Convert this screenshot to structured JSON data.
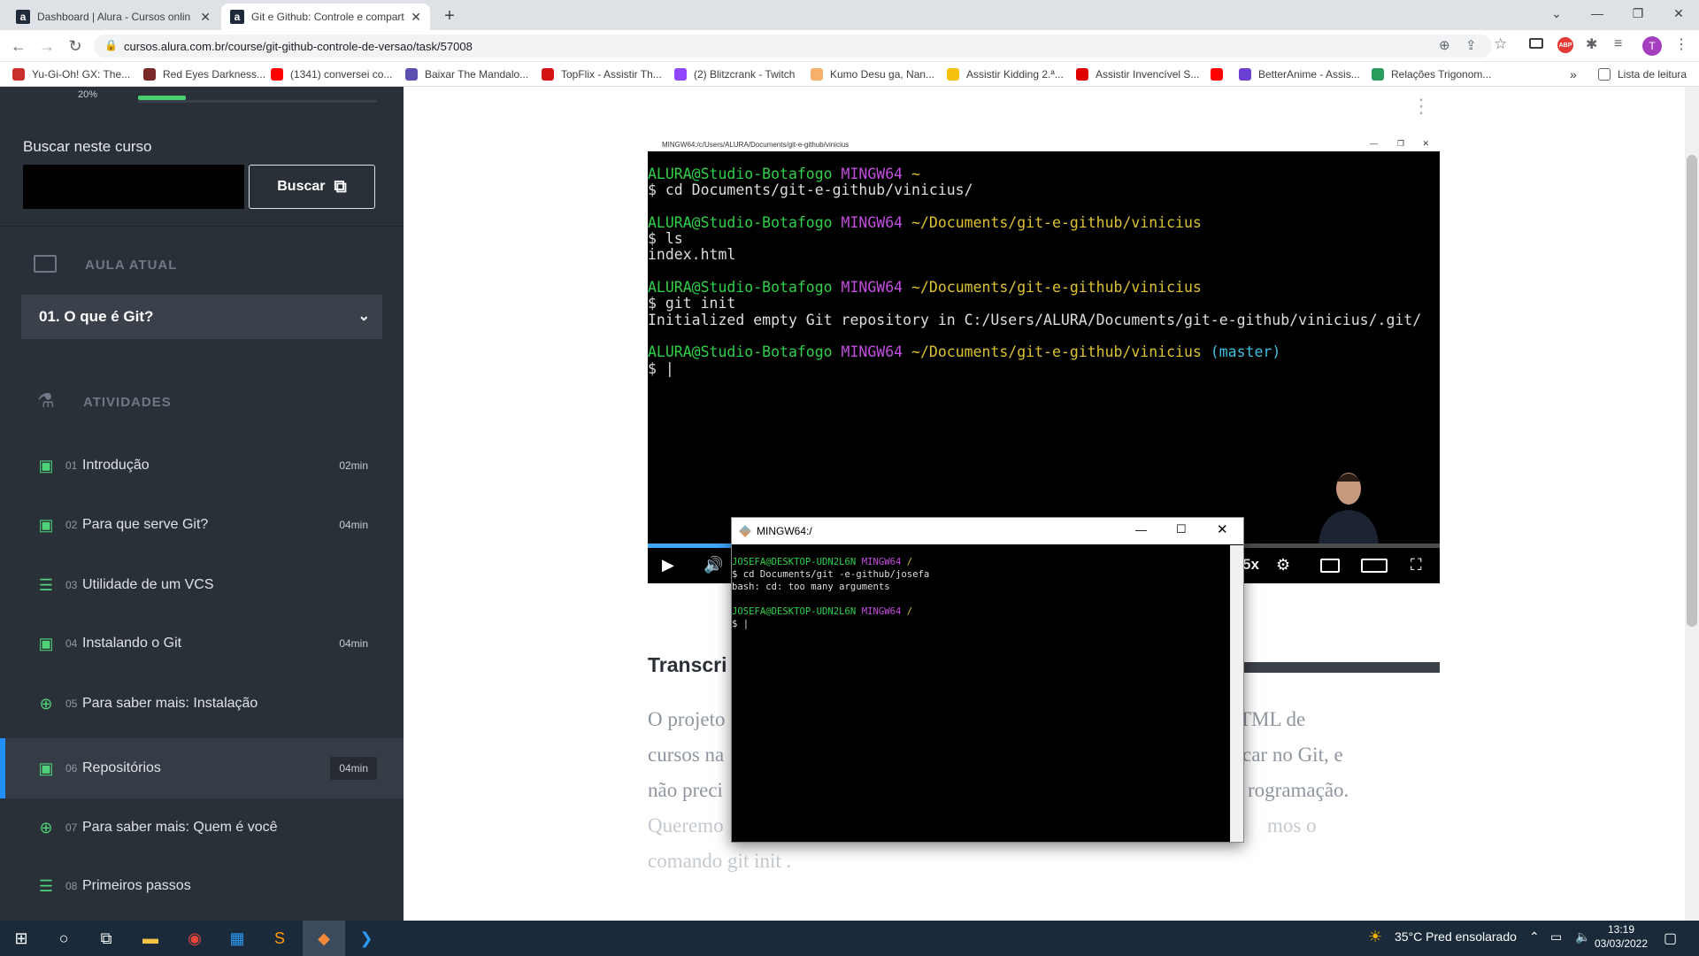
{
  "browser": {
    "tabs": [
      {
        "title": "Dashboard | Alura - Cursos onlin",
        "favicon": "a"
      },
      {
        "title": "Git e Github: Controle e compart",
        "favicon": "a"
      }
    ],
    "new_tab": "+",
    "url": "cursos.alura.com.br/course/git-github-controle-de-versao/task/57008",
    "profile_initial": "T",
    "bookmarks": [
      {
        "label": "Yu-Gi-Oh! GX: The...",
        "color": "#c9302c"
      },
      {
        "label": "Red Eyes Darkness...",
        "color": "#7b2a2a"
      },
      {
        "label": "(1341) conversei co...",
        "color": "#ff0000"
      },
      {
        "label": "Baixar The Mandalo...",
        "color": "#5b4fb0"
      },
      {
        "label": "TopFlix - Assistir Th...",
        "color": "#d41313"
      },
      {
        "label": "(2) Blitzcrank - Twitch",
        "color": "#9146ff"
      },
      {
        "label": "Kumo Desu ga, Nan...",
        "color": "#f6b26b"
      },
      {
        "label": "Assistir Kidding 2.ª...",
        "color": "#f4c20d"
      },
      {
        "label": "Assistir Invencível S...",
        "color": "#e00000"
      },
      {
        "label": "",
        "color": "#ff0000"
      },
      {
        "label": "BetterAnime - Assis...",
        "color": "#6a3fd1"
      },
      {
        "label": "Relações Trigonom...",
        "color": "#2a9d5c"
      }
    ],
    "more_bookmarks": "»",
    "reading_list": "Lista de leitura"
  },
  "sidebar": {
    "progress_percent": 20,
    "progress_label": "20%",
    "search_label": "Buscar neste curso",
    "search_placeholder": "",
    "search_button": "Buscar",
    "current_lesson_heading": "AULA ATUAL",
    "current_lesson": "01. O que é Git?",
    "activities_heading": "ATIVIDADES",
    "activities": [
      {
        "num": "01",
        "name": "Introdução",
        "duration": "02min",
        "icon": "video-icon",
        "active": false
      },
      {
        "num": "02",
        "name": "Para que serve Git?",
        "duration": "04min",
        "icon": "video-icon",
        "active": false
      },
      {
        "num": "03",
        "name": "Utilidade de um VCS",
        "duration": "",
        "icon": "list-icon",
        "active": false
      },
      {
        "num": "04",
        "name": "Instalando o Git",
        "duration": "04min",
        "icon": "video-icon",
        "active": false
      },
      {
        "num": "05",
        "name": "Para saber mais: Instalação",
        "duration": "",
        "icon": "plus-circle-icon",
        "active": false
      },
      {
        "num": "06",
        "name": "Repositórios",
        "duration": "04min",
        "icon": "video-icon",
        "active": true
      },
      {
        "num": "07",
        "name": "Para saber mais: Quem é você",
        "duration": "",
        "icon": "plus-circle-icon",
        "active": false
      },
      {
        "num": "08",
        "name": "Primeiros passos",
        "duration": "",
        "icon": "list-icon",
        "active": false
      }
    ]
  },
  "video": {
    "window_title": "MINGW64:/c/Users/ALURA/Documents/git-e-github/vinicius",
    "lines": [
      [
        {
          "t": "ALURA@Studio-Botafogo ",
          "c": "g"
        },
        {
          "t": "MINGW64 ",
          "c": "m"
        },
        {
          "t": "~",
          "c": "y"
        }
      ],
      [
        {
          "t": "$ cd Documents/git-e-github/vinicius/",
          "c": "w"
        }
      ],
      [
        {
          "t": "",
          "c": "w"
        }
      ],
      [
        {
          "t": "ALURA@Studio-Botafogo ",
          "c": "g"
        },
        {
          "t": "MINGW64 ",
          "c": "m"
        },
        {
          "t": "~/Documents/git-e-github/vinicius",
          "c": "y"
        }
      ],
      [
        {
          "t": "$ ls",
          "c": "w"
        }
      ],
      [
        {
          "t": "index.html",
          "c": "w"
        }
      ],
      [
        {
          "t": "",
          "c": "w"
        }
      ],
      [
        {
          "t": "ALURA@Studio-Botafogo ",
          "c": "g"
        },
        {
          "t": "MINGW64 ",
          "c": "m"
        },
        {
          "t": "~/Documents/git-e-github/vinicius",
          "c": "y"
        }
      ],
      [
        {
          "t": "$ git init",
          "c": "w"
        }
      ],
      [
        {
          "t": "Initialized empty Git repository in C:/Users/ALURA/Documents/git-e-github/vinicius/.git/",
          "c": "w"
        }
      ],
      [
        {
          "t": "",
          "c": "w"
        }
      ],
      [
        {
          "t": "ALURA@Studio-Botafogo ",
          "c": "g"
        },
        {
          "t": "MINGW64 ",
          "c": "m"
        },
        {
          "t": "~/Documents/git-e-github/vinicius",
          "c": "y"
        },
        {
          "t": " (master)",
          "c": "c"
        }
      ],
      [
        {
          "t": "$ |",
          "c": "w"
        }
      ]
    ],
    "speed_label": "5x",
    "progress": 0.12
  },
  "transcript": {
    "title": "Transcri",
    "lines": [
      {
        "left": "O projeto",
        "right": "TML de"
      },
      {
        "left": "cursos na",
        "right": "car no Git, e"
      },
      {
        "left": "não preci",
        "right": "rogramação."
      },
      {
        "left": "Queremo",
        "right": "mos o"
      },
      {
        "left": "comando  git init .",
        "right": ""
      }
    ]
  },
  "mingw_window": {
    "title": "MINGW64:/",
    "lines": [
      [
        {
          "t": "JOSEFA@DESKTOP-UDN2L6N ",
          "c": "g"
        },
        {
          "t": "MINGW64 ",
          "c": "m"
        },
        {
          "t": "/",
          "c": "y"
        }
      ],
      [
        {
          "t": "$ cd Documents/git -e-github/josefa",
          "c": "w"
        }
      ],
      [
        {
          "t": "bash: cd: too many arguments",
          "c": "w"
        }
      ],
      [
        {
          "t": "",
          "c": "w"
        }
      ],
      [
        {
          "t": "JOSEFA@DESKTOP-UDN2L6N ",
          "c": "g"
        },
        {
          "t": "MINGW64 ",
          "c": "m"
        },
        {
          "t": "/",
          "c": "y"
        }
      ],
      [
        {
          "t": "$ |",
          "c": "w"
        }
      ]
    ]
  },
  "taskbar": {
    "weather": "35°C  Pred ensolarado",
    "time": "13:19",
    "date": "03/03/2022"
  }
}
